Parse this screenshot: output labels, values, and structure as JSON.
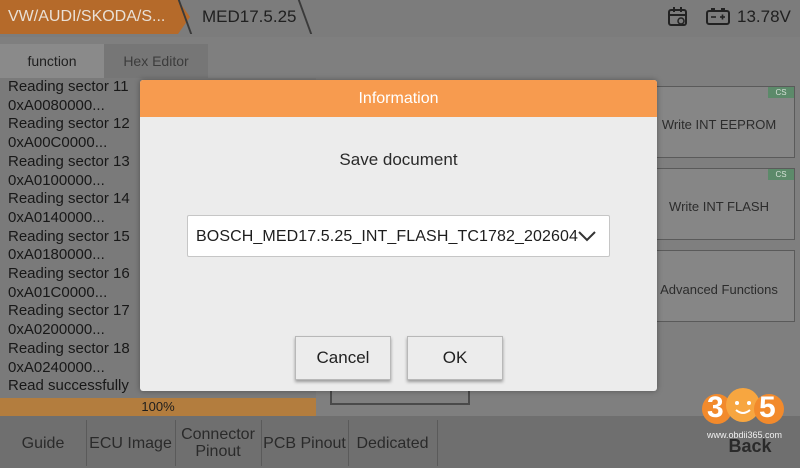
{
  "header": {
    "crumb_vehicle": "VW/AUDI/SKODA/S...",
    "crumb_ecu": "MED17.5.25",
    "voltage": "13.78V",
    "calendar_icon": "calendar-icon",
    "battery_icon": "battery-icon"
  },
  "tabs": [
    {
      "label": "function"
    },
    {
      "label": "Hex Editor"
    }
  ],
  "log_lines": [
    "Reading sector 11",
    "0xA0080000...",
    "Reading sector 12",
    "0xA00C0000...",
    "Reading sector 13",
    "0xA0100000...",
    "Reading sector 14",
    "0xA0140000...",
    "Reading sector 15",
    "0xA0180000...",
    "Reading sector 16",
    "0xA01C0000...",
    "Reading sector 17",
    "0xA0200000...",
    "Reading sector 18",
    "0xA0240000...",
    "Read successfully"
  ],
  "progress": {
    "text": "100%",
    "value": 1.0
  },
  "side_buttons": [
    {
      "label": "Write INT EEPROM",
      "badge": "CS"
    },
    {
      "label": "Write INT FLASH",
      "badge": "CS"
    },
    {
      "label": "Advanced Functions"
    }
  ],
  "bottom_bar": [
    {
      "label": "Guide"
    },
    {
      "label": "ECU Image"
    },
    {
      "label": "Connector Pinout"
    },
    {
      "label": "PCB Pinout"
    },
    {
      "label": "Dedicated"
    },
    {
      "label": "Back"
    }
  ],
  "dialog": {
    "title": "Information",
    "label": "Save document",
    "selected_file": "BOSCH_MED17.5.25_INT_FLASH_TC1782_202604",
    "cancel_label": "Cancel",
    "ok_label": "OK"
  },
  "watermark": {
    "digits": [
      "3",
      "6",
      "5"
    ],
    "url": "www.obdii365.com"
  },
  "colors": {
    "dialog_header": "#f79b4f",
    "dialog_body": "#ececec",
    "breadcrumb_active": "#b56a2a",
    "progress_fill": "#b37d3e",
    "cs_badge": "#5c8a6a"
  }
}
